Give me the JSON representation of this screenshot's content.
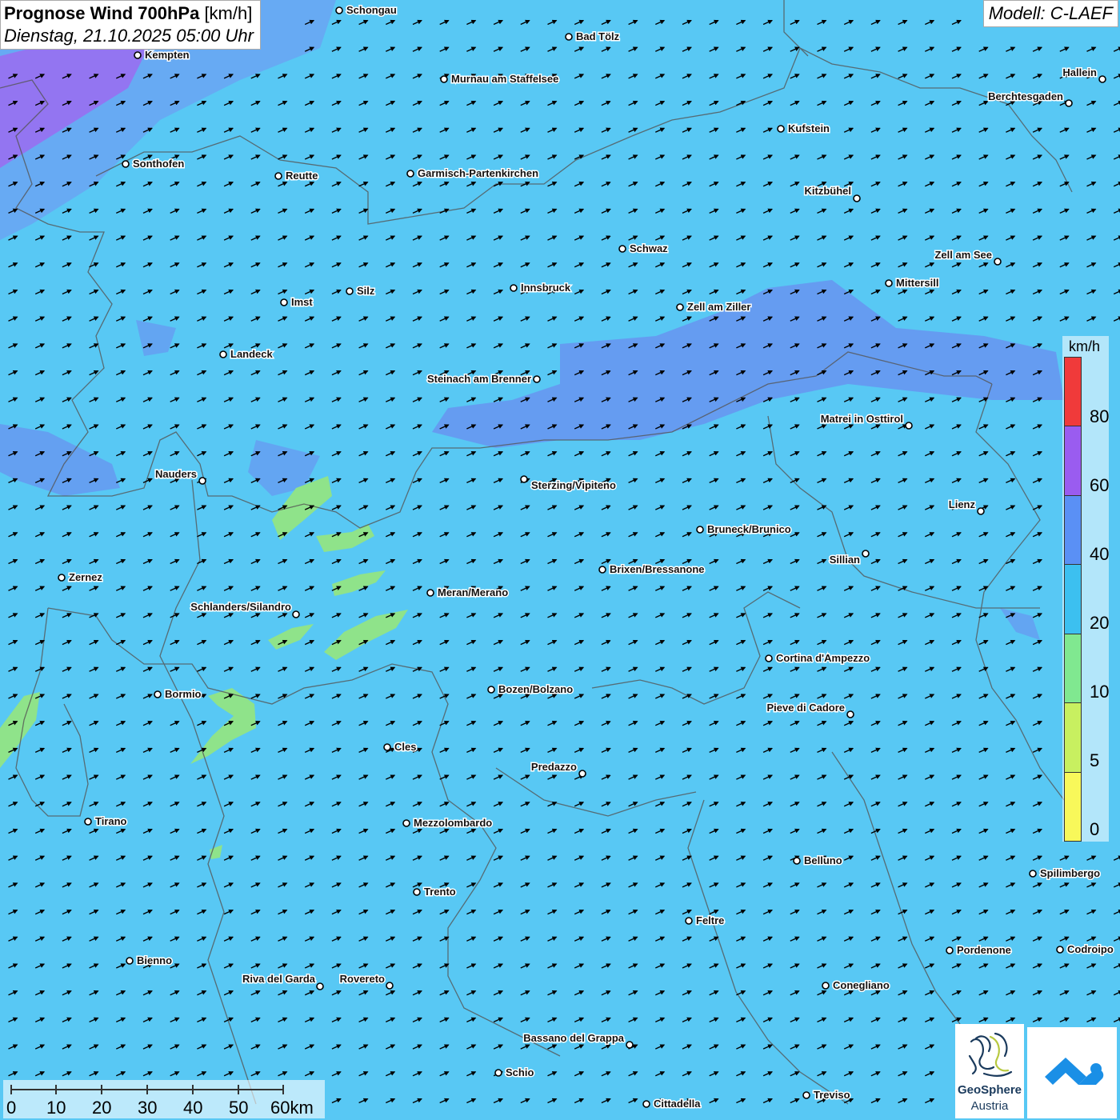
{
  "header": {
    "title_bold": "Prognose Wind 700hPa",
    "title_unit": "[km/h]",
    "datetime": "Dienstag, 21.10.2025 05:00 Uhr",
    "model": "Modell: C-LAEF"
  },
  "legend": {
    "unit": "km/h",
    "labels": [
      "80",
      "60",
      "40",
      "20",
      "10",
      "5",
      "0"
    ],
    "colors": [
      "#f03a3a",
      "#9a5cf0",
      "#5a90f5",
      "#3cc0f0",
      "#80e890",
      "#c8f060",
      "#f8f85a"
    ]
  },
  "scale_bar": {
    "labels": [
      "0",
      "10",
      "20",
      "30",
      "40",
      "50",
      "60km"
    ]
  },
  "logos": {
    "geosphere_line1": "GeoSphere",
    "geosphere_line2": "Austria"
  },
  "cities": [
    {
      "name": "Schongau"
    },
    {
      "name": "Bad Tölz"
    },
    {
      "name": "Kempten"
    },
    {
      "name": "Murnau am Staffelsee"
    },
    {
      "name": "Hallein"
    },
    {
      "name": "Berchtesgaden"
    },
    {
      "name": "Kufstein"
    },
    {
      "name": "Sonthofen"
    },
    {
      "name": "Reutte"
    },
    {
      "name": "Garmisch-Partenkirchen"
    },
    {
      "name": "Kitzbühel"
    },
    {
      "name": "Schwaz"
    },
    {
      "name": "Zell am See"
    },
    {
      "name": "Mittersill"
    },
    {
      "name": "Innsbruck"
    },
    {
      "name": "Silz"
    },
    {
      "name": "Imst"
    },
    {
      "name": "Zell am Ziller"
    },
    {
      "name": "Landeck"
    },
    {
      "name": "Steinach am Brenner"
    },
    {
      "name": "Matrei in Osttirol"
    },
    {
      "name": "Nauders"
    },
    {
      "name": "Sterzing/Vipiteno"
    },
    {
      "name": "Lienz"
    },
    {
      "name": "Bruneck/Brunico"
    },
    {
      "name": "Sillian"
    },
    {
      "name": "Zernez"
    },
    {
      "name": "Brixen/Bressanone"
    },
    {
      "name": "Meran/Merano"
    },
    {
      "name": "Schlanders/Silandro"
    },
    {
      "name": "Cortina d'Ampezzo"
    },
    {
      "name": "Bozen/Bolzano"
    },
    {
      "name": "Bormio"
    },
    {
      "name": "Pieve di Cadore"
    },
    {
      "name": "Cles"
    },
    {
      "name": "Predazzo"
    },
    {
      "name": "Tirano"
    },
    {
      "name": "Mezzolombardo"
    },
    {
      "name": "Belluno"
    },
    {
      "name": "Spilimbergo"
    },
    {
      "name": "Trento"
    },
    {
      "name": "Feltre"
    },
    {
      "name": "Pordenone"
    },
    {
      "name": "Codroipo"
    },
    {
      "name": "Bienno"
    },
    {
      "name": "Riva del Garda"
    },
    {
      "name": "Rovereto"
    },
    {
      "name": "Conegliano"
    },
    {
      "name": "Bassano del Grappa"
    },
    {
      "name": "Schio"
    },
    {
      "name": "Treviso"
    },
    {
      "name": "Cittadella"
    }
  ]
}
